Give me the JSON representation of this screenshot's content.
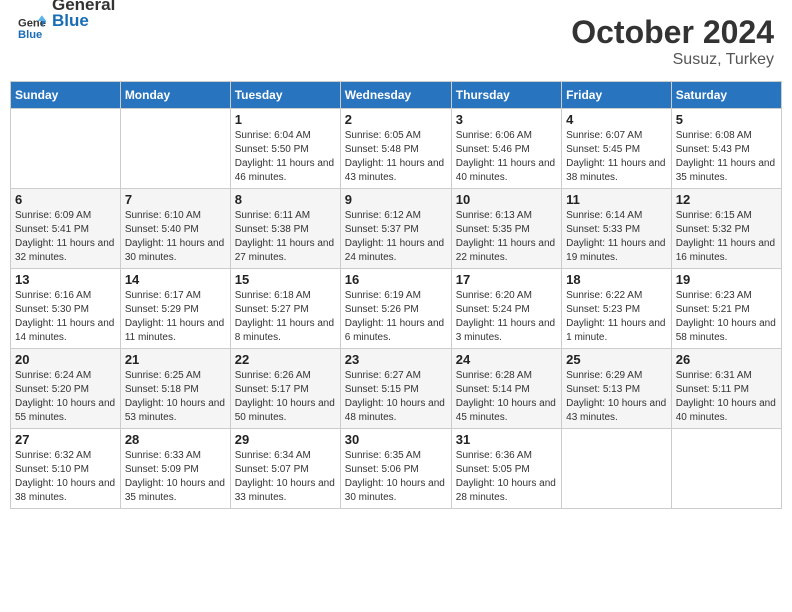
{
  "logo": {
    "general": "General",
    "blue": "Blue"
  },
  "header": {
    "month": "October 2024",
    "location": "Susuz, Turkey"
  },
  "weekdays": [
    "Sunday",
    "Monday",
    "Tuesday",
    "Wednesday",
    "Thursday",
    "Friday",
    "Saturday"
  ],
  "weeks": [
    [
      {
        "day": "",
        "sunrise": "",
        "sunset": "",
        "daylight": ""
      },
      {
        "day": "",
        "sunrise": "",
        "sunset": "",
        "daylight": ""
      },
      {
        "day": "1",
        "sunrise": "Sunrise: 6:04 AM",
        "sunset": "Sunset: 5:50 PM",
        "daylight": "Daylight: 11 hours and 46 minutes."
      },
      {
        "day": "2",
        "sunrise": "Sunrise: 6:05 AM",
        "sunset": "Sunset: 5:48 PM",
        "daylight": "Daylight: 11 hours and 43 minutes."
      },
      {
        "day": "3",
        "sunrise": "Sunrise: 6:06 AM",
        "sunset": "Sunset: 5:46 PM",
        "daylight": "Daylight: 11 hours and 40 minutes."
      },
      {
        "day": "4",
        "sunrise": "Sunrise: 6:07 AM",
        "sunset": "Sunset: 5:45 PM",
        "daylight": "Daylight: 11 hours and 38 minutes."
      },
      {
        "day": "5",
        "sunrise": "Sunrise: 6:08 AM",
        "sunset": "Sunset: 5:43 PM",
        "daylight": "Daylight: 11 hours and 35 minutes."
      }
    ],
    [
      {
        "day": "6",
        "sunrise": "Sunrise: 6:09 AM",
        "sunset": "Sunset: 5:41 PM",
        "daylight": "Daylight: 11 hours and 32 minutes."
      },
      {
        "day": "7",
        "sunrise": "Sunrise: 6:10 AM",
        "sunset": "Sunset: 5:40 PM",
        "daylight": "Daylight: 11 hours and 30 minutes."
      },
      {
        "day": "8",
        "sunrise": "Sunrise: 6:11 AM",
        "sunset": "Sunset: 5:38 PM",
        "daylight": "Daylight: 11 hours and 27 minutes."
      },
      {
        "day": "9",
        "sunrise": "Sunrise: 6:12 AM",
        "sunset": "Sunset: 5:37 PM",
        "daylight": "Daylight: 11 hours and 24 minutes."
      },
      {
        "day": "10",
        "sunrise": "Sunrise: 6:13 AM",
        "sunset": "Sunset: 5:35 PM",
        "daylight": "Daylight: 11 hours and 22 minutes."
      },
      {
        "day": "11",
        "sunrise": "Sunrise: 6:14 AM",
        "sunset": "Sunset: 5:33 PM",
        "daylight": "Daylight: 11 hours and 19 minutes."
      },
      {
        "day": "12",
        "sunrise": "Sunrise: 6:15 AM",
        "sunset": "Sunset: 5:32 PM",
        "daylight": "Daylight: 11 hours and 16 minutes."
      }
    ],
    [
      {
        "day": "13",
        "sunrise": "Sunrise: 6:16 AM",
        "sunset": "Sunset: 5:30 PM",
        "daylight": "Daylight: 11 hours and 14 minutes."
      },
      {
        "day": "14",
        "sunrise": "Sunrise: 6:17 AM",
        "sunset": "Sunset: 5:29 PM",
        "daylight": "Daylight: 11 hours and 11 minutes."
      },
      {
        "day": "15",
        "sunrise": "Sunrise: 6:18 AM",
        "sunset": "Sunset: 5:27 PM",
        "daylight": "Daylight: 11 hours and 8 minutes."
      },
      {
        "day": "16",
        "sunrise": "Sunrise: 6:19 AM",
        "sunset": "Sunset: 5:26 PM",
        "daylight": "Daylight: 11 hours and 6 minutes."
      },
      {
        "day": "17",
        "sunrise": "Sunrise: 6:20 AM",
        "sunset": "Sunset: 5:24 PM",
        "daylight": "Daylight: 11 hours and 3 minutes."
      },
      {
        "day": "18",
        "sunrise": "Sunrise: 6:22 AM",
        "sunset": "Sunset: 5:23 PM",
        "daylight": "Daylight: 11 hours and 1 minute."
      },
      {
        "day": "19",
        "sunrise": "Sunrise: 6:23 AM",
        "sunset": "Sunset: 5:21 PM",
        "daylight": "Daylight: 10 hours and 58 minutes."
      }
    ],
    [
      {
        "day": "20",
        "sunrise": "Sunrise: 6:24 AM",
        "sunset": "Sunset: 5:20 PM",
        "daylight": "Daylight: 10 hours and 55 minutes."
      },
      {
        "day": "21",
        "sunrise": "Sunrise: 6:25 AM",
        "sunset": "Sunset: 5:18 PM",
        "daylight": "Daylight: 10 hours and 53 minutes."
      },
      {
        "day": "22",
        "sunrise": "Sunrise: 6:26 AM",
        "sunset": "Sunset: 5:17 PM",
        "daylight": "Daylight: 10 hours and 50 minutes."
      },
      {
        "day": "23",
        "sunrise": "Sunrise: 6:27 AM",
        "sunset": "Sunset: 5:15 PM",
        "daylight": "Daylight: 10 hours and 48 minutes."
      },
      {
        "day": "24",
        "sunrise": "Sunrise: 6:28 AM",
        "sunset": "Sunset: 5:14 PM",
        "daylight": "Daylight: 10 hours and 45 minutes."
      },
      {
        "day": "25",
        "sunrise": "Sunrise: 6:29 AM",
        "sunset": "Sunset: 5:13 PM",
        "daylight": "Daylight: 10 hours and 43 minutes."
      },
      {
        "day": "26",
        "sunrise": "Sunrise: 6:31 AM",
        "sunset": "Sunset: 5:11 PM",
        "daylight": "Daylight: 10 hours and 40 minutes."
      }
    ],
    [
      {
        "day": "27",
        "sunrise": "Sunrise: 6:32 AM",
        "sunset": "Sunset: 5:10 PM",
        "daylight": "Daylight: 10 hours and 38 minutes."
      },
      {
        "day": "28",
        "sunrise": "Sunrise: 6:33 AM",
        "sunset": "Sunset: 5:09 PM",
        "daylight": "Daylight: 10 hours and 35 minutes."
      },
      {
        "day": "29",
        "sunrise": "Sunrise: 6:34 AM",
        "sunset": "Sunset: 5:07 PM",
        "daylight": "Daylight: 10 hours and 33 minutes."
      },
      {
        "day": "30",
        "sunrise": "Sunrise: 6:35 AM",
        "sunset": "Sunset: 5:06 PM",
        "daylight": "Daylight: 10 hours and 30 minutes."
      },
      {
        "day": "31",
        "sunrise": "Sunrise: 6:36 AM",
        "sunset": "Sunset: 5:05 PM",
        "daylight": "Daylight: 10 hours and 28 minutes."
      },
      {
        "day": "",
        "sunrise": "",
        "sunset": "",
        "daylight": ""
      },
      {
        "day": "",
        "sunrise": "",
        "sunset": "",
        "daylight": ""
      }
    ]
  ]
}
